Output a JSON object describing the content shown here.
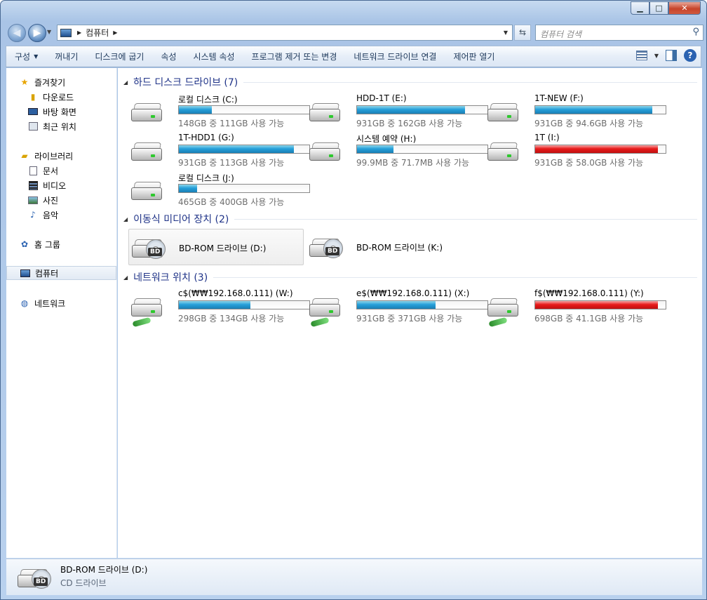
{
  "window": {
    "min_glyph": "▁",
    "max_glyph": "□",
    "close_glyph": "✕"
  },
  "address": {
    "crumb": "컴퓨터",
    "search_placeholder": "컴퓨터 검색"
  },
  "toolbar": {
    "organize": "구성",
    "eject": "꺼내기",
    "burn": "디스크에 굽기",
    "properties": "속성",
    "system_properties": "시스템 속성",
    "uninstall": "프로그램 제거 또는 변경",
    "map_drive": "네트워크 드라이브 연결",
    "control_panel": "제어판 열기",
    "help_glyph": "?"
  },
  "nav": {
    "favorites": "즐겨찾기",
    "downloads": "다운로드",
    "desktop": "바탕 화면",
    "recent": "최근 위치",
    "libraries": "라이브러리",
    "documents": "문서",
    "videos": "비디오",
    "pictures": "사진",
    "music": "음악",
    "homegroup": "홈 그룹",
    "computer": "컴퓨터",
    "network": "네트워크"
  },
  "groups": {
    "hdd": "하드 디스크 드라이브 (7)",
    "removable": "이동식 미디어 장치 (2)",
    "network": "네트워크 위치 (3)"
  },
  "drives": [
    {
      "name": "로컬 디스크 (C:)",
      "free": "148GB 중 111GB 사용 가능",
      "used": 0.25,
      "color": "#26a0da"
    },
    {
      "name": "HDD-1T (E:)",
      "free": "931GB 중 162GB 사용 가능",
      "used": 0.83,
      "color": "#26a0da"
    },
    {
      "name": "1T-NEW (F:)",
      "free": "931GB 중 94.6GB 사용 가능",
      "used": 0.9,
      "color": "#26a0da"
    },
    {
      "name": "1T-HDD1 (G:)",
      "free": "931GB 중 113GB 사용 가능",
      "used": 0.88,
      "color": "#26a0da"
    },
    {
      "name": "시스템 예약 (H:)",
      "free": "99.9MB 중 71.7MB 사용 가능",
      "used": 0.28,
      "color": "#26a0da"
    },
    {
      "name": "1T (I:)",
      "free": "931GB 중 58.0GB 사용 가능",
      "used": 0.94,
      "color": "#e81b1b"
    },
    {
      "name": "로컬 디스크 (J:)",
      "free": "465GB 중 400GB 사용 가능",
      "used": 0.14,
      "color": "#26a0da"
    }
  ],
  "removable": [
    {
      "name": "BD-ROM 드라이브 (D:)",
      "badge": "BD"
    },
    {
      "name": "BD-ROM 드라이브 (K:)",
      "badge": "BD"
    }
  ],
  "netdrives": [
    {
      "name": "c$(₩₩192.168.0.111) (W:)",
      "free": "298GB 중 134GB 사용 가능",
      "used": 0.55,
      "color": "#26a0da"
    },
    {
      "name": "e$(₩₩192.168.0.111) (X:)",
      "free": "931GB 중 371GB 사용 가능",
      "used": 0.6,
      "color": "#26a0da"
    },
    {
      "name": "f$(₩₩192.168.0.111) (Y:)",
      "free": "698GB 중 41.1GB 사용 가능",
      "used": 0.94,
      "color": "#e81b1b"
    }
  ],
  "details": {
    "name": "BD-ROM 드라이브 (D:)",
    "type": "CD 드라이브",
    "badge": "BD"
  }
}
